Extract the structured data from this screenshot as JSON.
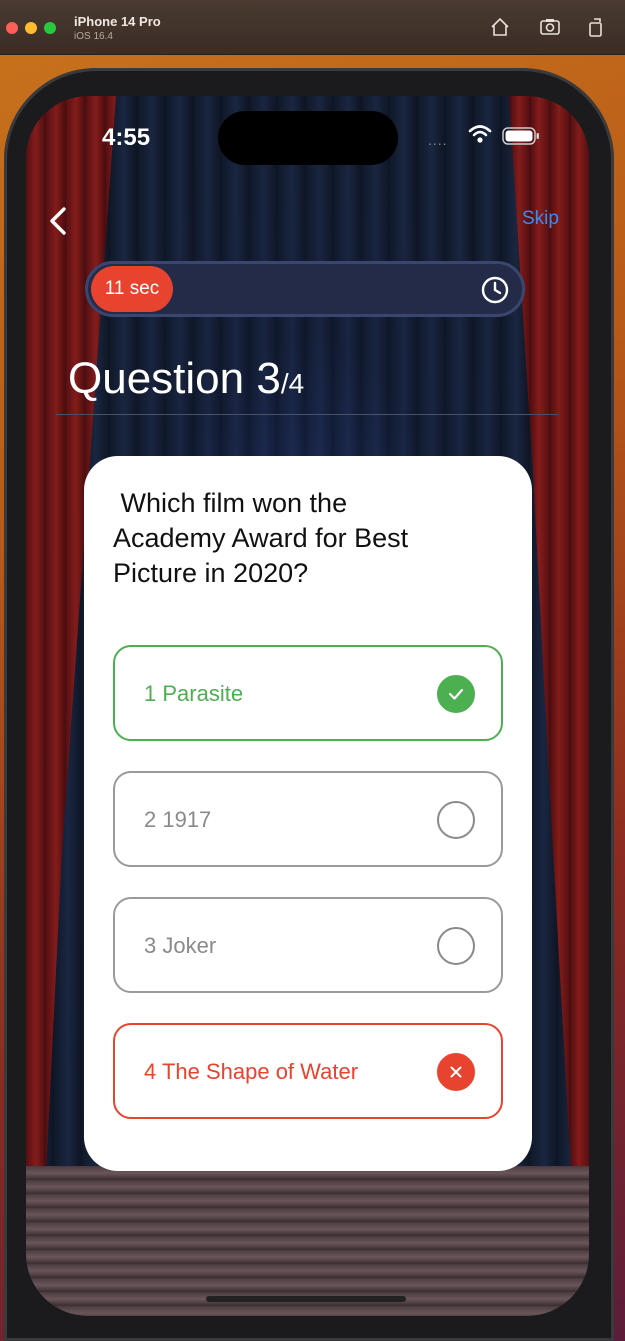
{
  "simulator": {
    "device_name": "iPhone 14 Pro",
    "os_version": "iOS 16.4",
    "icons": [
      "home-icon",
      "screenshot-icon",
      "rotate-icon"
    ]
  },
  "status_bar": {
    "time": "4:55",
    "dots": "....",
    "icons": [
      "wifi-icon",
      "battery-icon"
    ]
  },
  "nav": {
    "back_icon": "chevron-left-icon",
    "skip_label": "Skip"
  },
  "timer": {
    "label": "11 sec",
    "icon": "clock-icon",
    "color": "#e8432e"
  },
  "question": {
    "title_prefix": "Question 3",
    "total": "/4",
    "text": " Which film won the\nAcademy Award for Best\nPicture in 2020?"
  },
  "options": [
    {
      "label": "1 Parasite",
      "state": "correct",
      "icon": "check-icon",
      "color": "#4caf50"
    },
    {
      "label": "2 1917",
      "state": "unselected",
      "icon": "circle-icon",
      "color": "#8a8a8a"
    },
    {
      "label": "3 Joker",
      "state": "unselected",
      "icon": "circle-icon",
      "color": "#8a8a8a"
    },
    {
      "label": "4 The Shape of Water",
      "state": "wrong",
      "icon": "x-icon",
      "color": "#e8432e"
    }
  ]
}
